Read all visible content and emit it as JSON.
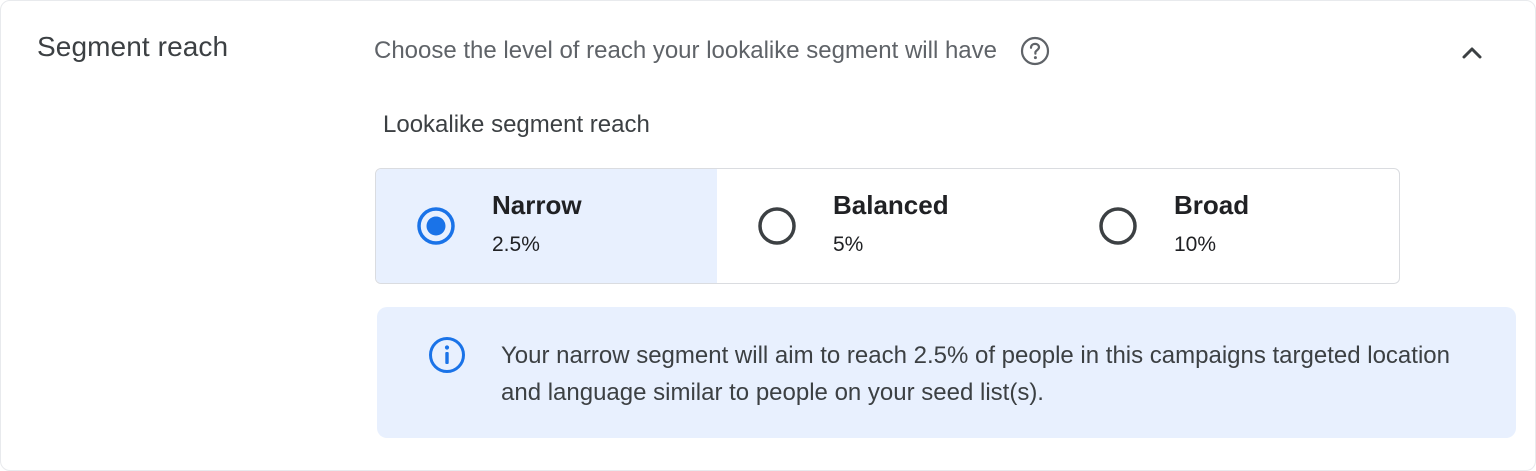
{
  "section": {
    "title": "Segment reach",
    "description": "Choose the level of reach your lookalike segment will have",
    "help_icon": "help-circle-icon",
    "collapse_icon": "chevron-up-icon"
  },
  "reach": {
    "label": "Lookalike segment reach",
    "selected": "Narrow",
    "options": [
      {
        "title": "Narrow",
        "value": "2.5%"
      },
      {
        "title": "Balanced",
        "value": "5%"
      },
      {
        "title": "Broad",
        "value": "10%"
      }
    ]
  },
  "info": {
    "icon": "info-icon",
    "text": "Your narrow segment will aim to reach 2.5% of people in this campaigns targeted location and language similar to people on your seed list(s)."
  },
  "colors": {
    "accent": "#1a73e8",
    "selected_bg": "#e8f0fe",
    "info_bg": "#e8f0fe",
    "radio_unselected": "#3c4043"
  }
}
